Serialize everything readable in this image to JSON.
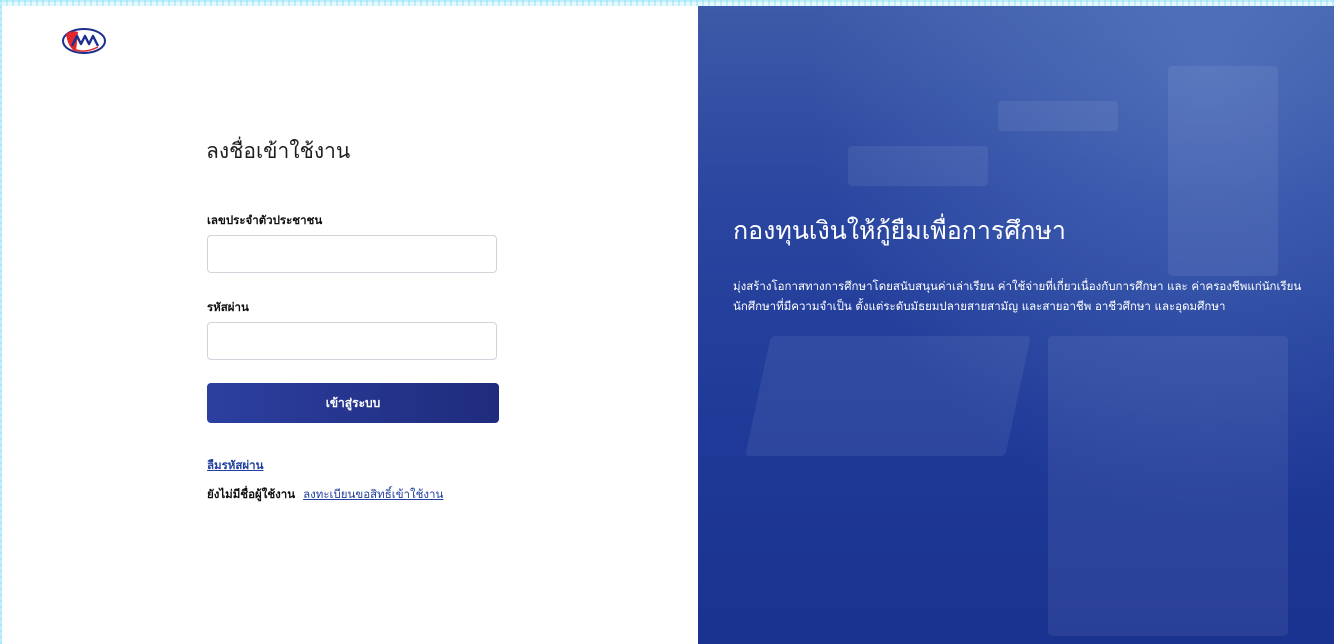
{
  "brand": {
    "logo_icon": "kyf-logo-icon",
    "accent": "#263593",
    "hero_bg": "#223c9c"
  },
  "login": {
    "title": "ลงชื่อเข้าใช้งาน",
    "id_label": "เลขประจำตัวประชาชน",
    "id_value": "",
    "password_label": "รหัสผ่าน",
    "password_value": "",
    "submit_label": "เข้าสู่ระบบ",
    "forgot_password": "ลืมรหัสผ่าน",
    "no_account_text": "ยังไม่มีชื่อผู้ใช้งาน",
    "register_link": "ลงทะเบียนขอสิทธิ์เข้าใช้งาน"
  },
  "hero": {
    "title": "กองทุนเงินให้กู้ยืมเพื่อการศึกษา",
    "description": "มุ่งสร้างโอกาสทางการศึกษาโดยสนับสนุนค่าเล่าเรียน ค่าใช้จ่ายที่เกี่ยวเนื่องกับการศึกษา และ ค่าครองชีพแก่นักเรียน นักศึกษาที่มีความจำเป็น ตั้งแต่ระดับมัธยมปลายสายสามัญ และสายอาชีพ อาชีวศึกษา และอุดมศึกษา"
  }
}
